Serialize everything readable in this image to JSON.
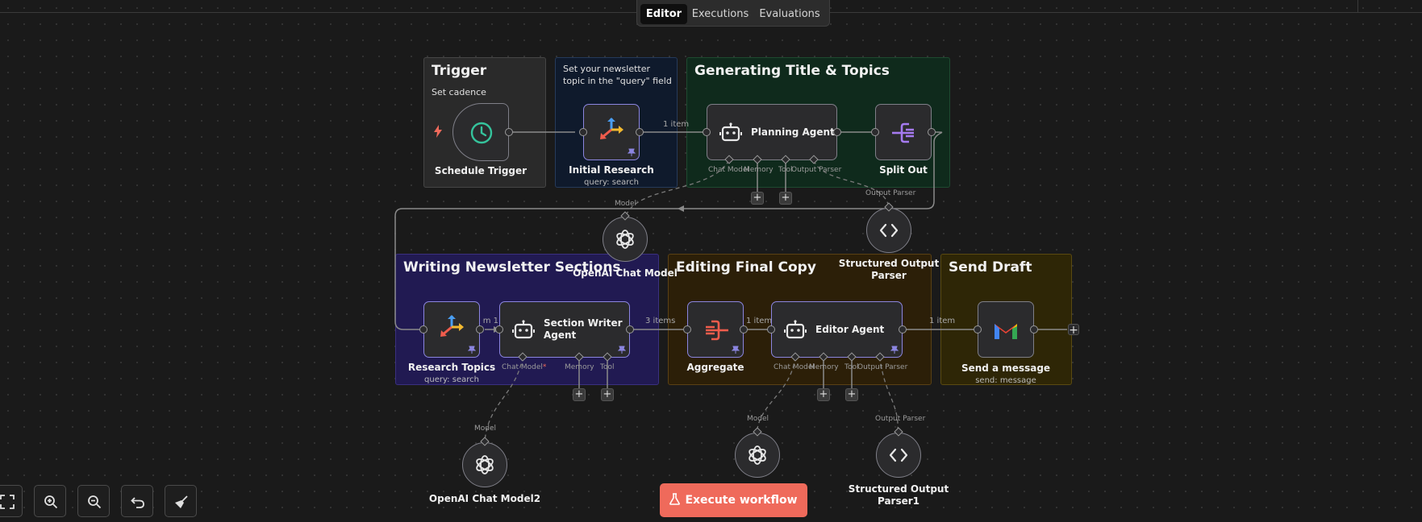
{
  "tabs": {
    "editor": "Editor",
    "executions": "Executions",
    "evaluations": "Evaluations"
  },
  "stickies": {
    "trigger": {
      "title": "Trigger",
      "subtitle": "Set cadence"
    },
    "query_note": {
      "text": "Set your newsletter topic in the \"query\" field"
    },
    "planning": {
      "title": "Generating Title & Topics"
    },
    "writing": {
      "title": "Writing Newsletter Sections"
    },
    "editing": {
      "title": "Editing Final Copy"
    },
    "send": {
      "title": "Send Draft"
    }
  },
  "nodes": {
    "schedule_trigger": {
      "label": "Schedule Trigger"
    },
    "initial_research": {
      "label": "Initial Research",
      "sub": "query: search"
    },
    "planning_agent": {
      "label": "Planning Agent"
    },
    "split_out": {
      "label": "Split Out"
    },
    "research_topics": {
      "label": "Research Topics",
      "sub": "query: search"
    },
    "section_writer": {
      "label": "Section Writer Agent"
    },
    "aggregate": {
      "label": "Aggregate"
    },
    "editor_agent": {
      "label": "Editor Agent"
    },
    "send_message": {
      "label": "Send a message",
      "sub": "send: message"
    },
    "openai_model": {
      "label": "OpenAI Chat Model"
    },
    "openai_model2": {
      "label": "OpenAI Chat Model2"
    },
    "structured_parser": {
      "label": "Structured Output Parser"
    },
    "structured_parser1": {
      "label": "Structured Output Parser1"
    }
  },
  "sub_ports": {
    "planning": {
      "chat_model": "Chat Model",
      "memory": "Memory",
      "tool": "Tool",
      "output_parser": "Output Parser"
    },
    "writer": {
      "chat_model": "Chat Model",
      "required": "*",
      "memory": "Memory",
      "tool": "Tool"
    },
    "editor": {
      "chat_model": "Chat Model",
      "memory": "Memory",
      "tool": "Tool",
      "output_parser": "Output Parser"
    },
    "model_label": "Model",
    "output_parser_label": "Output Parser"
  },
  "connections": {
    "research_to_planning": "1 item",
    "research_to_writer": "1 item",
    "writer_to_aggregate": "3 items",
    "aggregate_to_editor": "1 item",
    "editor_to_send": "1 item"
  },
  "toolbar": {
    "execute": "Execute workflow"
  },
  "colors": {
    "sticky_gray": "#2a2a2a",
    "sticky_blue": "#0f1a2c",
    "sticky_green": "#0f2a1c",
    "sticky_purple": "#211a52",
    "sticky_brown": "#2c1f08",
    "sticky_olive": "#2e2606",
    "accent_execute": "#ef6a5b",
    "pinned_border": "#8b85e0"
  }
}
